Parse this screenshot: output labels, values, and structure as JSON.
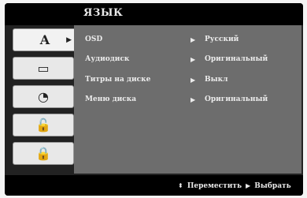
{
  "menu": {
    "title": "ЯЗЫК",
    "tabs": [
      {
        "glyph": "A",
        "name": "tab-language",
        "icon": "language-icon",
        "active": true
      },
      {
        "glyph": "▭",
        "name": "tab-display",
        "icon": "display-icon",
        "active": false
      },
      {
        "glyph": "◔",
        "name": "tab-audio",
        "icon": "audio-icon",
        "active": false
      },
      {
        "glyph": "🔓",
        "name": "tab-lock",
        "icon": "unlock-icon",
        "active": false
      },
      {
        "glyph": "🔒",
        "name": "tab-other",
        "icon": "lock-icon",
        "active": false
      }
    ],
    "rows": [
      {
        "label": "OSD",
        "value": "Русский"
      },
      {
        "label": "Аудиодиск",
        "value": "Оригинальный"
      },
      {
        "label": "Титры на диске",
        "value": "Выкл"
      },
      {
        "label": "Меню диска",
        "value": "Оригинальный"
      }
    ],
    "footer": {
      "navigate": "Переместить",
      "select": "Выбрать"
    }
  }
}
